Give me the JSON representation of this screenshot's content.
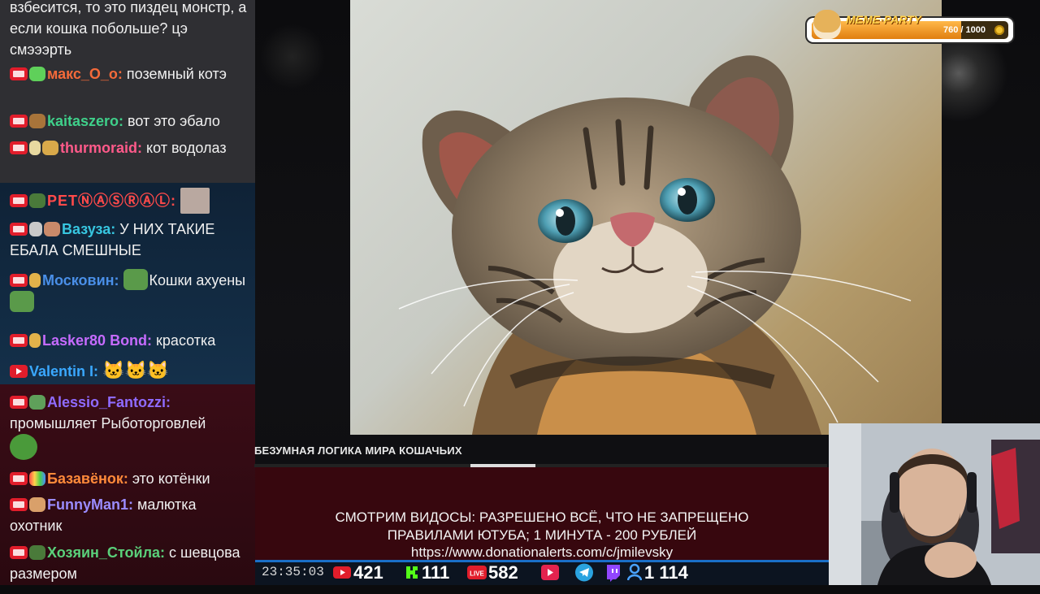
{
  "chat": {
    "messages": [
      {
        "text": "взбесится, то это пиздец монстр, а если кошка побольше? цэ смэээрть"
      },
      {
        "nick": "макс_O_o:",
        "text": " поземный котэ"
      },
      {
        "nick": "kaitaszero:",
        "text": " вот это эбало"
      },
      {
        "nick": "thurmoraid:",
        "text": " кот водолаз"
      },
      {
        "nick": "PETⓃⒶⓈⓇⒶⓁ:"
      },
      {
        "nick": "Вазуза:",
        "text": " У НИХ ТАКИЕ ЕБАЛА СМЕШНЫЕ"
      },
      {
        "nick": "Московин:",
        "text": "Кошки ахуены"
      },
      {
        "nick": "Lasker80 Bond:",
        "text": " красотка"
      },
      {
        "nick": "Valentin I:",
        "text": "🐱🐱🐱"
      },
      {
        "nick": "Alessio_Fantozzi:",
        "text": " промышляет Рыботорговлей"
      },
      {
        "nick": "Базавёнок:",
        "text": " это котёнки"
      },
      {
        "nick": "FunnyMan1:",
        "text": " малютка охотник"
      },
      {
        "nick": "Хозяин_Стойла:",
        "text": " с шевцова размером"
      }
    ]
  },
  "colors": {
    "nick_makc": "#f46a3a",
    "nick_kaitas": "#3fd08a",
    "nick_thurmo": "#ff5a8a",
    "nick_pet": "#ff4a4a",
    "nick_vazuza": "#37c6e0",
    "nick_moskovin": "#4a8fe8",
    "nick_lasker": "#c66bff",
    "nick_valentin": "#3aa8ff",
    "nick_alessio": "#8f6bff",
    "nick_bazav": "#ff8a3a",
    "nick_funny": "#9b8cff",
    "nick_hozyain": "#5ad07a"
  },
  "video": {
    "title": "БЕЗУМНАЯ ЛОГИКА МИРА КОШАЧЬИХ"
  },
  "donation": {
    "line1": "СМОТРИМ ВИДОСЫ: РАЗРЕШЕНО ВСЁ, ЧТО НЕ ЗАПРЕЩЕНО",
    "line2": "ПРАВИЛАМИ ЮТУБА; 1 МИНУТА - 200 РУБЛЕЙ",
    "url": "https://www.donationalerts.com/c/jmilevsky"
  },
  "stats": {
    "time": "23:35:03",
    "youtube": "421",
    "kick": "111",
    "live": "582",
    "viewers": "1 114"
  },
  "meme_party": {
    "label": "MEME·PARTY",
    "progress_text": "760 / 1000",
    "progress": 0.76
  }
}
